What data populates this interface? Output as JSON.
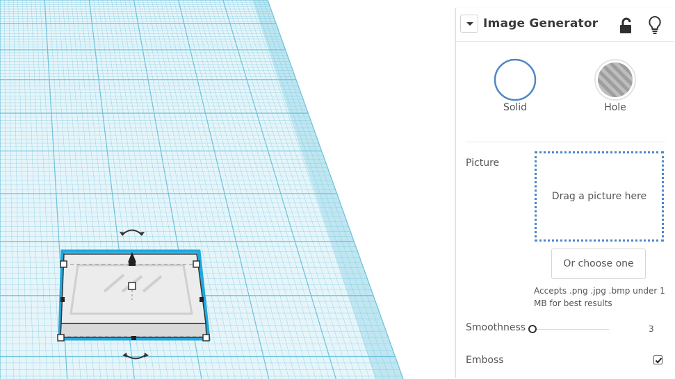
{
  "panel": {
    "title": "Image Generator",
    "icons": {
      "collapse": "chevron-down-icon",
      "lock": "unlock-icon",
      "hint": "lightbulb-icon"
    },
    "solid_label": "Solid",
    "hole_label": "Hole",
    "picture_label": "Picture",
    "drop_text": "Drag a picture here",
    "choose_label": "Or choose one",
    "accepts_text": "Accepts .png .jpg .bmp under 1 MB for best results",
    "smoothness_label": "Smoothness",
    "smoothness_value": "3",
    "emboss_label": "Emboss",
    "emboss_checked": true
  },
  "colors": {
    "grid_fill": "#bfe6f1",
    "grid_line": "#66c0da",
    "selection_outline": "#21a8de",
    "solid_ring": "#4f86c6",
    "drop_zone_border": "#4a86c8"
  }
}
